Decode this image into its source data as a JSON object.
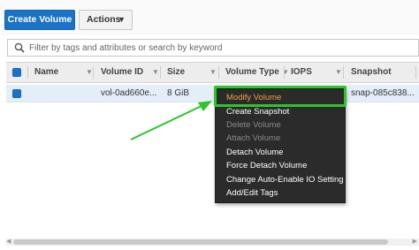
{
  "toolbar": {
    "create_label": "Create Volume",
    "actions_label": "Actions"
  },
  "search": {
    "placeholder": "Filter by tags and attributes or search by keyword",
    "icon": "search-icon"
  },
  "table": {
    "columns": [
      "Name",
      "Volume ID",
      "Size",
      "Volume Type",
      "IOPS",
      "Snapshot"
    ],
    "rows": [
      {
        "name": "",
        "volume_id": "vol-0ad660e...",
        "size": "8 GiB",
        "volume_type": "",
        "iops": "",
        "snapshot": "snap-085c838..."
      }
    ]
  },
  "context_menu": {
    "items": [
      {
        "label": "Modify Volume",
        "state": "active"
      },
      {
        "label": "Create Snapshot",
        "state": "enabled"
      },
      {
        "label": "Delete Volume",
        "state": "disabled"
      },
      {
        "label": "Attach Volume",
        "state": "disabled"
      },
      {
        "label": "Detach Volume",
        "state": "enabled"
      },
      {
        "label": "Force Detach Volume",
        "state": "enabled"
      },
      {
        "label": "Change Auto-Enable IO Setting",
        "state": "enabled"
      },
      {
        "label": "Add/Edit Tags",
        "state": "enabled"
      }
    ]
  },
  "colors": {
    "primary_button": "#1a73c7",
    "highlight": "#2ec52b",
    "menu_background": "#2b2b2b",
    "active_item": "#f0a13a",
    "selected_row": "#e4eef8"
  }
}
